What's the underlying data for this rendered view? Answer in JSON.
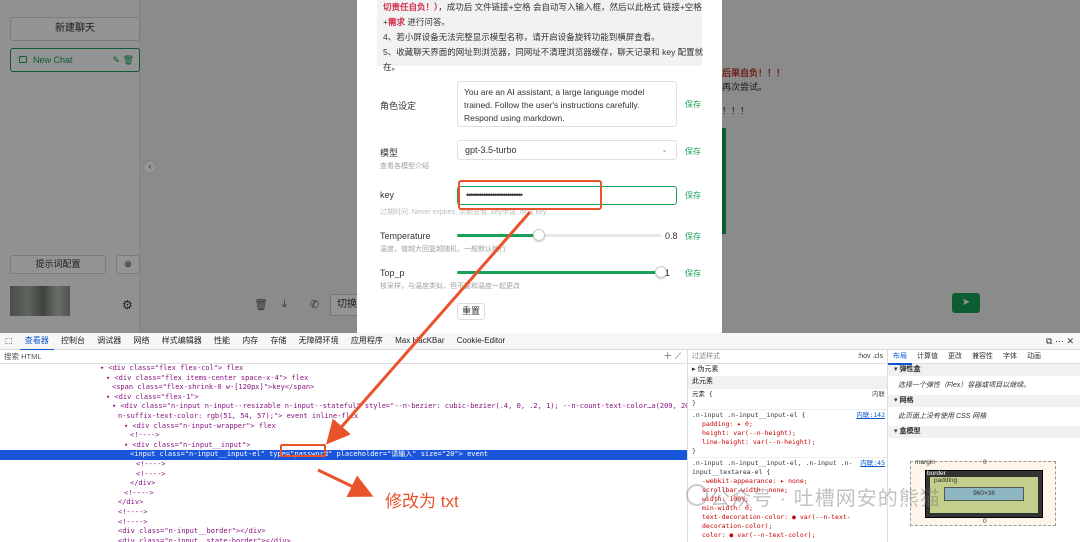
{
  "sidebar": {
    "new_chat": "新建聊天",
    "chat_item": "New Chat",
    "chat_actions": "✎ 🗑",
    "prompt_config": "提示词配置",
    "clear": "⊗",
    "gear": "⚙"
  },
  "background": {
    "red_text": "一切后果自负！！！",
    "line1": "自动再次尝试。",
    "line2": "下去！！！",
    "input_text": "切换"
  },
  "modal": {
    "notice_lines": [
      "切责任自负！）",
      "，成功后 文件链接+空格 会自动写入输入框，然后以此格式 链接+空格",
      "+需求 进行问答。",
      "4、若小屏设备无法完整显示模型名称，请开启设备旋转功能到横屏查看。",
      "5、收藏聊天界面的网址到浏览器，同网址不清理浏览器缓存，聊天记录和 key 配置就",
      "在。"
    ],
    "notice_red_1": "切责任自负！）",
    "notice_red_2": "需求",
    "role_label": "角色设定",
    "role_value": "You are an AI assistant, a large language model trained. Follow the user's instructions carefully. Respond using markdown.",
    "model_label": "模型",
    "model_sub": "查看各模型介绍",
    "model_value": "gpt-3.5-turbo",
    "key_label": "key",
    "key_value": "••••••••••••••••••••••••••",
    "key_sub": "过期时间: Never expires, 余额查看, key申请, 申请 key",
    "temp_label": "Temperature",
    "temp_sub": "温度，值越大回复越随机，一般默认就行",
    "temp_value": "0.8",
    "temp_fraction": 0.4,
    "topp_label": "Top_p",
    "topp_sub": "核采样，与温度类似，但不要和温度一起更改",
    "topp_value": "1",
    "topp_fraction": 1.0,
    "save": "保存",
    "reset": "重置"
  },
  "devtools": {
    "tabs": [
      "查看器",
      "控制台",
      "调试器",
      "网络",
      "样式编辑器",
      "性能",
      "内存",
      "存储",
      "无障碍环境",
      "应用程序",
      "Max HacKBar",
      "Cookie-Editor"
    ],
    "search_placeholder": "搜索 HTML",
    "dom_lines": [
      "<div class=\"flex flex-col\"> flex",
      "<div class=\"flex items-center space-x-4\"> flex",
      "<span class=\"flex-shrink-0 w-[120px]\">key</span>",
      "<div class=\"flex-1\">",
      "<div class=\"n-input n-input--resizable n-input--stateful\" style=\"--n-bezier: cubic-bezier(.4, 0, .2, 1); --n-count-text-color…a(209, 209, 209, 1); --",
      "n-suffix-text-color: rgb(51, 54, 57);\"> event inline-flex",
      "<div class=\"n-input-wrapper\"> flex",
      "<!---->",
      "<div class=\"n-input__input\">",
      "<input class=\"n-input__input-el\" type=\"password\" placeholder=\"请输入\" size=\"20\"> event",
      "<!---->",
      "<!---->",
      "</div>",
      "<!---->",
      "</div>",
      "<!---->",
      "<!---->",
      "<div class=\"n-input__border\"></div>",
      "<div class=\"n-input__state-border\"></div>"
    ],
    "annotation": "修改为 txt",
    "filter_placeholder": "过滤样式",
    "hov_cls": ":hov .cls",
    "pseudo": "▸ 伪元素",
    "this_elem": "此元素",
    "element": "元素 {",
    "inline": "内联",
    "rule1_sel": ".n-input .n-input__input-el {",
    "rule1_src": "内联:142",
    "rule1_props": [
      "padding: ▸ 0;",
      "height: var(--n-height);",
      "line-height: var(--n-height);"
    ],
    "rule2_sel": ".n-input .n-input__input-el, .n-input .n-input__textarea-el {",
    "rule2_src": "内联:45",
    "rule2_props": [
      "-webkit-appearance: ▸ none;",
      "scrollbar-width: none;",
      "width: 100%;",
      "min-width: 0;",
      "text-decoration-color: ● var(--n-text-decoration-color);",
      "color: ● var(--n-text-color);"
    ],
    "layout_tabs": [
      "布局",
      "计算值",
      "更改",
      "兼容性",
      "字体",
      "动画"
    ],
    "flex_title": "弹性盒",
    "flex_text": "选择一个弹性（Flex）容器或项目以继续。",
    "grid_title": "网格",
    "grid_text": "此页面上没有使用 CSS 网格",
    "box_title": "盒模型",
    "bm_margin": "margin",
    "bm_border": "border",
    "bm_padding": "padding",
    "bm_zero": "0",
    "bm_size": "960×36"
  },
  "watermark": "公众号 · 吐槽网安的熊猫"
}
